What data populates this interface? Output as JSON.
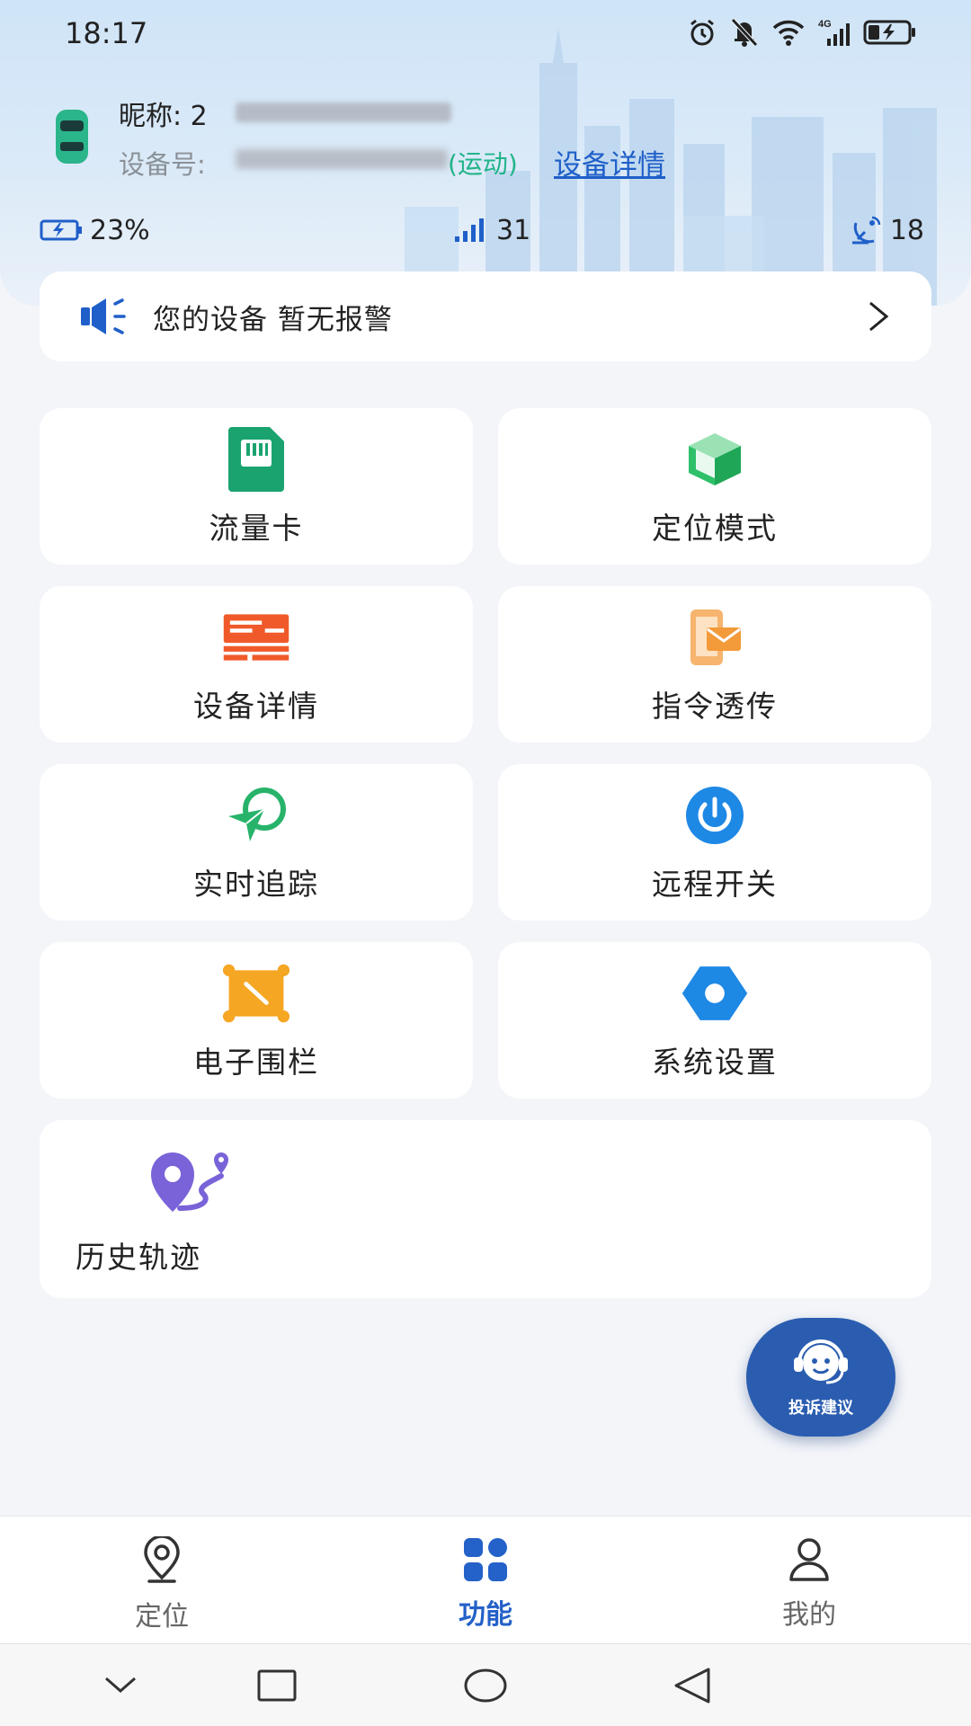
{
  "status_bar": {
    "time": "18:17",
    "icons": [
      "alarm-icon",
      "mute-icon",
      "wifi-icon",
      "4g-signal-icon",
      "battery-charging-icon"
    ],
    "network_label": "4G"
  },
  "device": {
    "nickname_label": "昵称: 2",
    "device_no_label": "设备号:",
    "state_text": "(运动)",
    "detail_link": "设备详情"
  },
  "stats": {
    "battery": "23%",
    "signal": "31",
    "satellites": "18"
  },
  "alert": {
    "text": "您的设备 暂无报警"
  },
  "features": [
    {
      "label": "流量卡",
      "icon": "sim-card-icon",
      "color": "#1aa36f"
    },
    {
      "label": "定位模式",
      "icon": "cube-icon",
      "color": "#2fc06a"
    },
    {
      "label": "设备详情",
      "icon": "device-detail-icon",
      "color": "#f05a2a"
    },
    {
      "label": "指令透传",
      "icon": "phone-message-icon",
      "color": "#f39a3a"
    },
    {
      "label": "实时追踪",
      "icon": "tracking-icon",
      "color": "#28b36b"
    },
    {
      "label": "远程开关",
      "icon": "power-icon",
      "color": "#1e88e5"
    },
    {
      "label": "电子围栏",
      "icon": "fence-icon",
      "color": "#f5a623"
    },
    {
      "label": "系统设置",
      "icon": "settings-icon",
      "color": "#1e88e5"
    },
    {
      "label": "历史轨迹",
      "icon": "route-icon",
      "color": "#7a63d8"
    }
  ],
  "fab": {
    "label": "投诉建议"
  },
  "tabs": [
    {
      "label": "定位",
      "icon": "location-pin-icon",
      "active": false
    },
    {
      "label": "功能",
      "icon": "grid-icon",
      "active": true
    },
    {
      "label": "我的",
      "icon": "user-icon",
      "active": false
    }
  ],
  "colors": {
    "accent": "#2461c8",
    "link": "#1f5fc9",
    "state_green": "#22b48a",
    "fab": "#2a5db0"
  }
}
